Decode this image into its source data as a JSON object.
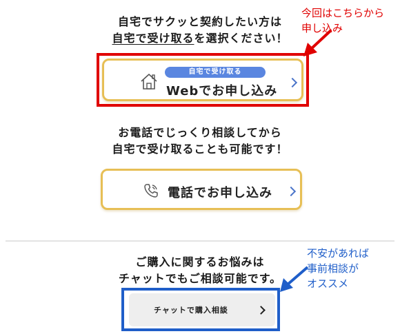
{
  "web_section": {
    "heading_line1": "自宅でサクッと契約したい方は",
    "heading_line2_underlined": "自宅で受け取る",
    "heading_line2_rest": "を選択ください！",
    "button_badge": "自宅で受け取る",
    "button_label": "Webでお申し込み"
  },
  "phone_section": {
    "heading_line1": "お電話でじっくり相談してから",
    "heading_line2": "自宅で受け取ることも可能です！",
    "button_label": "電話でお申し込み"
  },
  "chat_section": {
    "heading_line1": "ご購入に関するお悩みは",
    "heading_line2": "チャットでもご相談可能です。",
    "button_label": "チャットで購入相談"
  },
  "annotations": {
    "red_note_line1": "今回はこちらから",
    "red_note_line2": "申し込み",
    "blue_note_line1": "不安があれば",
    "blue_note_line2": "事前相談が",
    "blue_note_line3": "オススメ",
    "red_color": "#e00000",
    "blue_color": "#1f5ec9"
  },
  "icons": {
    "web": "house-icon",
    "phone": "phone-icon"
  },
  "colors": {
    "button_border": "#e7bf55",
    "badge": "#5a86e0",
    "chevron": "#4a74c9"
  }
}
